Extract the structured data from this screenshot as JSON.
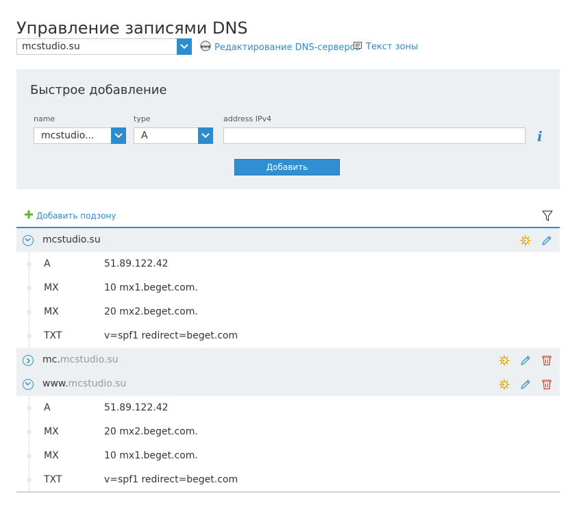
{
  "header": {
    "title": "Управление записями DNS"
  },
  "domain_select": {
    "value": "mcstudio.su"
  },
  "links": {
    "edit_dns": "Редактирование DNS-серверов",
    "zone_text": "Текст зоны"
  },
  "quick_add": {
    "title": "Быстрое добавление",
    "name_label": "name",
    "name_value": "mcstudio...",
    "type_label": "type",
    "type_value": "A",
    "address_label": "address IPv4",
    "address_value": "",
    "add_button": "Добавить"
  },
  "toolbar": {
    "add_subzone": "Добавить подзону"
  },
  "zones": [
    {
      "prefix": "mcstudio.su",
      "suffix": "",
      "expanded": true,
      "records": [
        {
          "type": "A",
          "value": "51.89.122.42"
        },
        {
          "type": "MX",
          "value": "10 mx1.beget.com."
        },
        {
          "type": "MX",
          "value": "20 mx2.beget.com."
        },
        {
          "type": "TXT",
          "value": "v=spf1 redirect=beget.com"
        }
      ]
    },
    {
      "prefix": "mc.",
      "suffix": "mcstudio.su",
      "expanded": false,
      "records": []
    },
    {
      "prefix": "www.",
      "suffix": "mcstudio.su",
      "expanded": true,
      "records": [
        {
          "type": "A",
          "value": "51.89.122.42"
        },
        {
          "type": "MX",
          "value": "20 mx2.beget.com."
        },
        {
          "type": "MX",
          "value": "10 mx1.beget.com."
        },
        {
          "type": "TXT",
          "value": "v=spf1 redirect=beget.com"
        }
      ]
    }
  ],
  "colors": {
    "accent": "#2d8ccd",
    "panel": "#edf0f2",
    "delete": "#c0392b",
    "sun": "#e8a800"
  }
}
